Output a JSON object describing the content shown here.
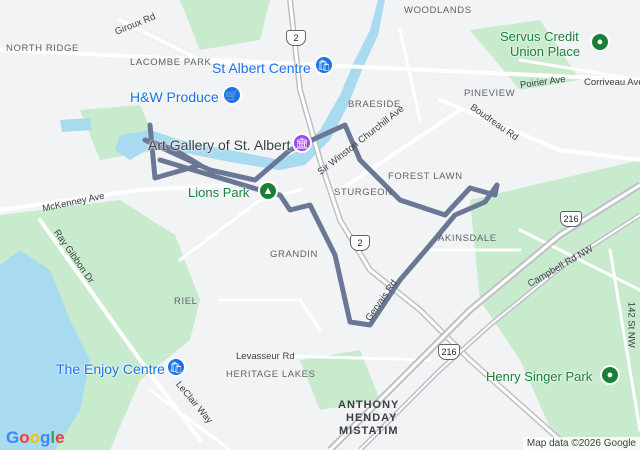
{
  "map": {
    "attribution": "Map data ©2026 Google",
    "logo": [
      "G",
      "o",
      "o",
      "g",
      "l",
      "e"
    ],
    "logo_colors": [
      "#4285F4",
      "#EA4335",
      "#FBBC05",
      "#4285F4",
      "#34A853",
      "#EA4335"
    ],
    "colors": {
      "route": "#6b7895",
      "water": "#a8daf0",
      "park": "#c8ebce",
      "road": "#ffffff",
      "highway": "#9aa0a6",
      "poi_blue": "#1a73e8",
      "poi_green": "#188038",
      "poi_purple": "#a142f4"
    }
  },
  "areas": {
    "woodlands": "WOODLANDS",
    "north_ridge": "NORTH RIDGE",
    "lacombe_park": "LACOMBE PARK",
    "braeside": "BRAESIDE",
    "pineview": "PINEVIEW",
    "forest_lawn": "FOREST LAWN",
    "sturgeon": "STURGEON",
    "akinsdale": "AKINSDALE",
    "grandin": "GRANDIN",
    "riel": "RIEL",
    "heritage_lakes": "HERITAGE LAKES",
    "anthony_henday": "ANTHONY",
    "anthony_henday_2": "HENDAY",
    "mistatim": "MISTATIM"
  },
  "streets": {
    "giroux": "Giroux Rd",
    "mckenney": "McKenney Ave",
    "ray_gibbon": "Ray Gibbon Dr",
    "sir_winston": "Sir Winston Churchill Ave",
    "boudreau": "Boudreau Rd",
    "poirier": "Poirier Ave",
    "corriveau": "Corriveau Ave",
    "gervais": "Gervais Rd",
    "campbell": "Campbell Rd NW",
    "st142": "142 St NW",
    "levasseur": "Levasseur Rd",
    "leclair": "LeClair Way"
  },
  "pois": {
    "st_albert_centre": "St Albert Centre",
    "hw_produce": "H&W Produce",
    "art_gallery": "Art Gallery of St. Albert",
    "lions_park": "Lions Park",
    "servus_1": "Servus Credit",
    "servus_2": "Union Place",
    "enjoy_centre": "The Enjoy Centre",
    "henry_singer": "Henry Singer Park"
  },
  "shields": {
    "hwy2_north": "2",
    "hwy2_south": "2",
    "hwy216_east": "216",
    "hwy216_south": "216"
  },
  "icons": {
    "st_albert_centre": "shopping-bag-icon",
    "hw_produce": "shopping-cart-icon",
    "art_gallery": "museum-icon",
    "lions_park": "tree-icon",
    "servus": "place-pin-icon",
    "enjoy_centre": "shopping-bag-icon",
    "henry_singer": "place-pin-icon"
  }
}
